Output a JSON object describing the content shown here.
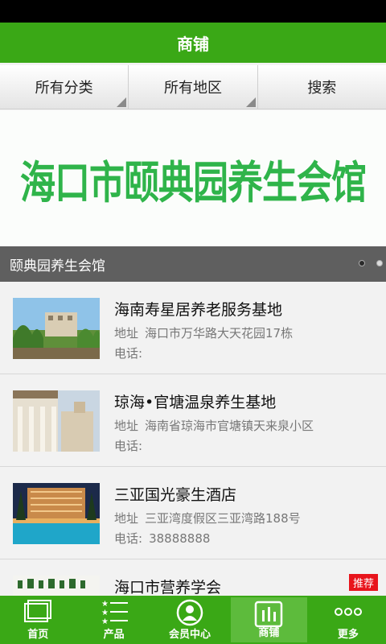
{
  "header": {
    "title": "商铺"
  },
  "filters": [
    {
      "label": "所有分类"
    },
    {
      "label": "所有地区"
    },
    {
      "label": "搜索"
    }
  ],
  "banner": {
    "text": "海口市颐典园养生会馆",
    "caption": "颐典园养生会馆",
    "page_count": 2,
    "active_page": 1
  },
  "listings": [
    {
      "title": "海南寿星居养老服务基地",
      "address_label": "地址",
      "address": "海口市万华路大天花园17栋",
      "phone_label": "电话:",
      "phone": ""
    },
    {
      "title": "琼海•官塘温泉养生基地",
      "address_label": "地址",
      "address": "海南省琼海市官塘镇天来泉小区",
      "phone_label": "电话:",
      "phone": ""
    },
    {
      "title": "三亚国光豪生酒店",
      "address_label": "地址",
      "address": "三亚湾度假区三亚湾路188号",
      "phone_label": "电话:",
      "phone": "38888888"
    },
    {
      "title": "海口市营养学会",
      "badge": "推荐"
    }
  ],
  "tabbar": [
    {
      "label": "首页",
      "icon": "home-icon"
    },
    {
      "label": "产品",
      "icon": "product-list-icon"
    },
    {
      "label": "会员中心",
      "icon": "member-icon"
    },
    {
      "label": "商铺",
      "icon": "shop-icon",
      "active": true
    },
    {
      "label": "更多",
      "icon": "more-icon"
    }
  ],
  "colors": {
    "brand_green": "#3aa816",
    "banner_text": "#2fb44a",
    "badge_red": "#e8141c"
  }
}
